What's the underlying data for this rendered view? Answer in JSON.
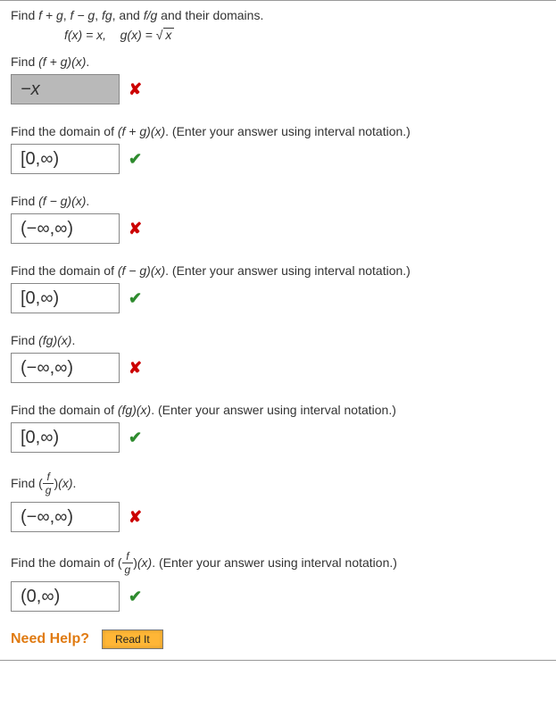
{
  "intro": {
    "line1_prefix": "Find ",
    "expr1": "f + g",
    "sep": ",  ",
    "expr2": "f − g",
    "expr3": "fg",
    "and": ",  and  ",
    "expr4": "f/g",
    "tail": " and their domains."
  },
  "functions": {
    "f_label": "f(x) = x,",
    "g_label_prefix": "g(x) = ",
    "radical": "√",
    "radicand": "x"
  },
  "parts": [
    {
      "prompt_prefix": "Find  ",
      "prompt_math": "(f + g)(x)",
      "prompt_suffix": ".",
      "answer": "−x",
      "status": "wrong",
      "disabled": true
    },
    {
      "prompt_prefix": "Find the domain of  ",
      "prompt_math": "(f + g)(x)",
      "prompt_suffix": ".  (Enter your answer using interval notation.)",
      "answer": "[0,∞)",
      "status": "correct",
      "disabled": false
    },
    {
      "prompt_prefix": "Find  ",
      "prompt_math": "(f − g)(x)",
      "prompt_suffix": ".",
      "answer": "(−∞,∞)",
      "status": "wrong",
      "disabled": false
    },
    {
      "prompt_prefix": "Find the domain of  ",
      "prompt_math": "(f − g)(x)",
      "prompt_suffix": ".  (Enter your answer using interval notation.)",
      "answer": "[0,∞)",
      "status": "correct",
      "disabled": false
    },
    {
      "prompt_prefix": "Find  ",
      "prompt_math": "(fg)(x)",
      "prompt_suffix": ".",
      "answer": "(−∞,∞)",
      "status": "wrong",
      "disabled": false
    },
    {
      "prompt_prefix": "Find the domain of  ",
      "prompt_math": "(fg)(x)",
      "prompt_suffix": ".  (Enter your answer using interval notation.)",
      "answer": "[0,∞)",
      "status": "correct",
      "disabled": false
    },
    {
      "prompt_prefix": "Find  ",
      "prompt_is_frac": true,
      "frac_num": "f",
      "frac_den": "g",
      "prompt_math_tail": "(x)",
      "prompt_suffix": ".",
      "answer": "(−∞,∞)",
      "status": "wrong",
      "disabled": false
    },
    {
      "prompt_prefix": "Find the domain of  ",
      "prompt_is_frac": true,
      "frac_num": "f",
      "frac_den": "g",
      "prompt_math_tail": "(x)",
      "prompt_suffix": ".  (Enter your answer using interval notation.)",
      "answer": "(0,∞)",
      "status": "correct",
      "disabled": false
    }
  ],
  "help": {
    "label": "Need Help?",
    "read_it": "Read It"
  },
  "marks": {
    "wrong": "✘",
    "correct": "✔"
  }
}
